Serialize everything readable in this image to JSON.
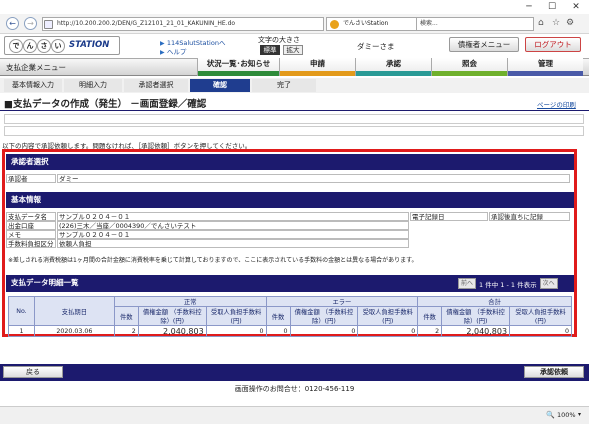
{
  "browser": {
    "url": "http://10.200.200.2/DEN/G_Z12101_21_01_KAKUNIN_HE.do",
    "tab_title": "でんさいStation",
    "search_placeholder": "検索...",
    "zoom": "100%"
  },
  "header": {
    "logo_chars": [
      "で",
      "ん",
      "さ",
      "い"
    ],
    "logo_suffix": "STATION",
    "link1": "114SalutStationへ",
    "link2": "ヘルプ",
    "font_size_label": "文字の大きさ",
    "font_standard": "標準",
    "font_large": "拡大",
    "user": "ダミーさま",
    "creditor_menu": "債権者メニュー",
    "logout": "ログアウト"
  },
  "menu": {
    "section_title": "支払企業メニュー",
    "tabs": [
      {
        "label": "状況一覧･お知らせ",
        "color": "#2e8b3a"
      },
      {
        "label": "申請",
        "color": "#e39a1b"
      },
      {
        "label": "承認",
        "color": "#2a9a96"
      },
      {
        "label": "照会",
        "color": "#6fb02c"
      },
      {
        "label": "管理",
        "color": "#4a5aa8"
      }
    ]
  },
  "steps": [
    "基本情報入力",
    "明細入力",
    "承認者選択",
    "確認",
    "完了"
  ],
  "page": {
    "title": "■支払データの作成（発生） －画面登録／確認",
    "print_link": "ページの印刷",
    "instruction": "以下の内容で承認依頼します。問題なければ、［承認依頼］ボタンを押してください。"
  },
  "approver": {
    "section": "承認者選択",
    "label": "承認者",
    "value": "ダミー"
  },
  "basic": {
    "section": "基本情報",
    "rows": [
      {
        "label": "支払データ名",
        "value": "サンプル０２０４－０１"
      },
      {
        "label": "出金口座",
        "value": "(226)三木／当座／0004390／でんさいテスト"
      },
      {
        "label": "メモ",
        "value": "サンプル０２０４－０１"
      },
      {
        "label": "手数料負担区分",
        "value": "依頼人負担"
      }
    ],
    "e_record_label": "電子記録日",
    "e_record_value": "承認後直ちに記録",
    "note": "※差しされる消費税額は1ヶ月間の合計金額に消費税率を乗じて計算しておりますので、ここに表示されている手数料の金額とは異なる場合があります。"
  },
  "detail": {
    "section": "支払データ明細一覧",
    "pager": {
      "prev": "前へ",
      "info": "1 件中 1 - 1 件表示",
      "next": "次へ"
    },
    "headers": {
      "no": "No.",
      "date": "支払期日",
      "normal": "正常",
      "error": "エラー",
      "total": "合計",
      "count": "件数",
      "amount": "債権金額 （手数料控除）(円)",
      "fee": "受取人負担手数料 (円)"
    },
    "rows": [
      {
        "no": "1",
        "date": "2020.03.06",
        "n_count": "2",
        "n_amount": "2,040,803",
        "n_fee": "0",
        "e_count": "0",
        "e_amount": "0",
        "e_fee": "0",
        "t_count": "2",
        "t_amount": "2,040,803",
        "t_fee": "0"
      }
    ]
  },
  "footer": {
    "back": "戻る",
    "submit": "承認依頼",
    "contact": "画面操作のお問合せ：0120-456-119"
  }
}
